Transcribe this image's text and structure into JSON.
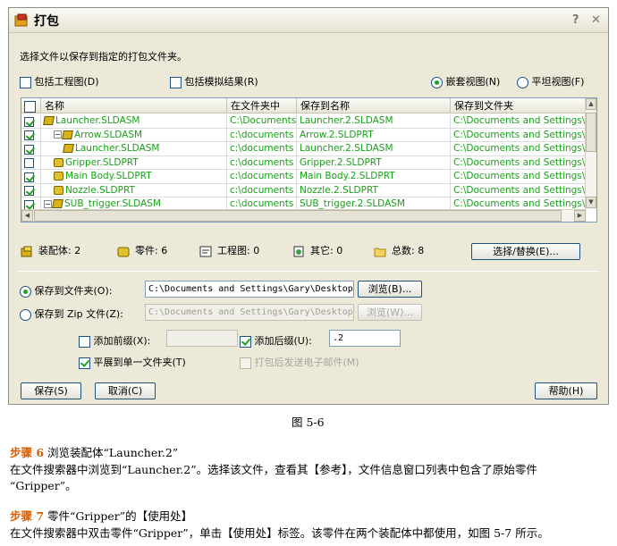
{
  "dialog": {
    "title": "打包",
    "help_btn": "?",
    "close_btn": "✕",
    "instruction": "选择文件以保存到指定的打包文件夹。",
    "opt_drawings": "包括工程图(D)",
    "opt_sim": "包括模拟结果(R)",
    "view_nested": "嵌套视图(N)",
    "view_flat": "平坦视图(F)",
    "columns": [
      "名称",
      "在文件夹中",
      "保存到名称",
      "保存到文件夹"
    ],
    "rows": [
      {
        "name": "Launcher.SLDASM",
        "folder": "C:\\Documents a",
        "save_name": "Launcher.2.SLDASM",
        "save_folder": "C:\\Documents and Settings\\Gary\\",
        "checked": true,
        "indent": 0,
        "expand": "",
        "icon": "assembly-icon"
      },
      {
        "name": "Arrow.SLDASM",
        "folder": "c:\\documents a",
        "save_name": "Arrow.2.SLDPRT",
        "save_folder": "C:\\Documents and Settings\\Gary\\",
        "checked": true,
        "indent": 1,
        "expand": "−",
        "icon": "assembly-icon"
      },
      {
        "name": "Launcher.SLDASM",
        "folder": "c:\\documents a",
        "save_name": "Launcher.2.SLDASM",
        "save_folder": "C:\\Documents and Settings\\Gary\\",
        "checked": true,
        "indent": 2,
        "expand": "",
        "icon": "assembly-icon"
      },
      {
        "name": "Gripper.SLDPRT",
        "folder": "c:\\documents a",
        "save_name": "Gripper.2.SLDPRT",
        "save_folder": "C:\\Documents and Settings\\Gary\\",
        "checked": false,
        "indent": 1,
        "expand": "",
        "icon": "part-icon"
      },
      {
        "name": "Main Body.SLDPRT",
        "folder": "c:\\documents a",
        "save_name": "Main Body.2.SLDPRT",
        "save_folder": "C:\\Documents and Settings\\Gary\\",
        "checked": true,
        "indent": 1,
        "expand": "",
        "icon": "part-icon"
      },
      {
        "name": "Nozzle.SLDPRT",
        "folder": "c:\\documents a",
        "save_name": "Nozzle.2.SLDPRT",
        "save_folder": "C:\\Documents and Settings\\Gary\\",
        "checked": true,
        "indent": 1,
        "expand": "",
        "icon": "part-icon"
      },
      {
        "name": "SUB_trigger.SLDASM",
        "folder": "c:\\documents a",
        "save_name": "SUB_trigger.2.SLDASM",
        "save_folder": "C:\\Documents and Settings\\Gary\\",
        "checked": true,
        "indent": 0,
        "expand": "−",
        "icon": "assembly-icon"
      }
    ],
    "stats": {
      "assemblies": "装配体: 2",
      "parts": "零件: 6",
      "drawings": "工程图: 0",
      "other": "其它: 0",
      "total": "总数: 8"
    },
    "select_replace_btn": "选择/替换(E)...",
    "save_folder_label": "保存到文件夹(O):",
    "save_folder_path": "C:\\Documents and Settings\\Gary\\Desktop\\",
    "browse_btn": "浏览(B)...",
    "save_zip_label": "保存到 Zip 文件(Z):",
    "save_zip_path": "C:\\Documents and Settings\\Gary\\Desktop\\",
    "browse_zip_btn": "浏览(W)...",
    "add_prefix_label": "添加前缀(X):",
    "add_suffix_label": "添加后缀(U):",
    "suffix_value": ".2",
    "flatten_label": "平展到单一文件夹(T)",
    "email_label": "打包后发送电子邮件(M)",
    "save_btn": "保存(S)",
    "cancel_btn": "取消(C)",
    "help_btn_label": "帮助(H)"
  },
  "document": {
    "figure_caption": "图 5-6",
    "step6_label": "步骤 6",
    "step6_title": "浏览装配体“Launcher.2”",
    "step6_body": "在文件搜索器中浏览到“Launcher.2”。选择该文件，查看其【参考】，文件信息窗口列表中包含了原始零件",
    "step6_body2": "“Gripper”。",
    "step7_label": "步骤 7",
    "step7_title": "零件“Gripper”的【使用处】",
    "step7_body": "在文件搜索器中双击零件“Gripper”，单击【使用处】标签。该零件在两个装配体中都使用，如图 5-7 所示。"
  },
  "colors": {
    "accent_green": "#19a119",
    "step_orange": "#d95c00",
    "dialog_bg": "#ece9d8"
  }
}
